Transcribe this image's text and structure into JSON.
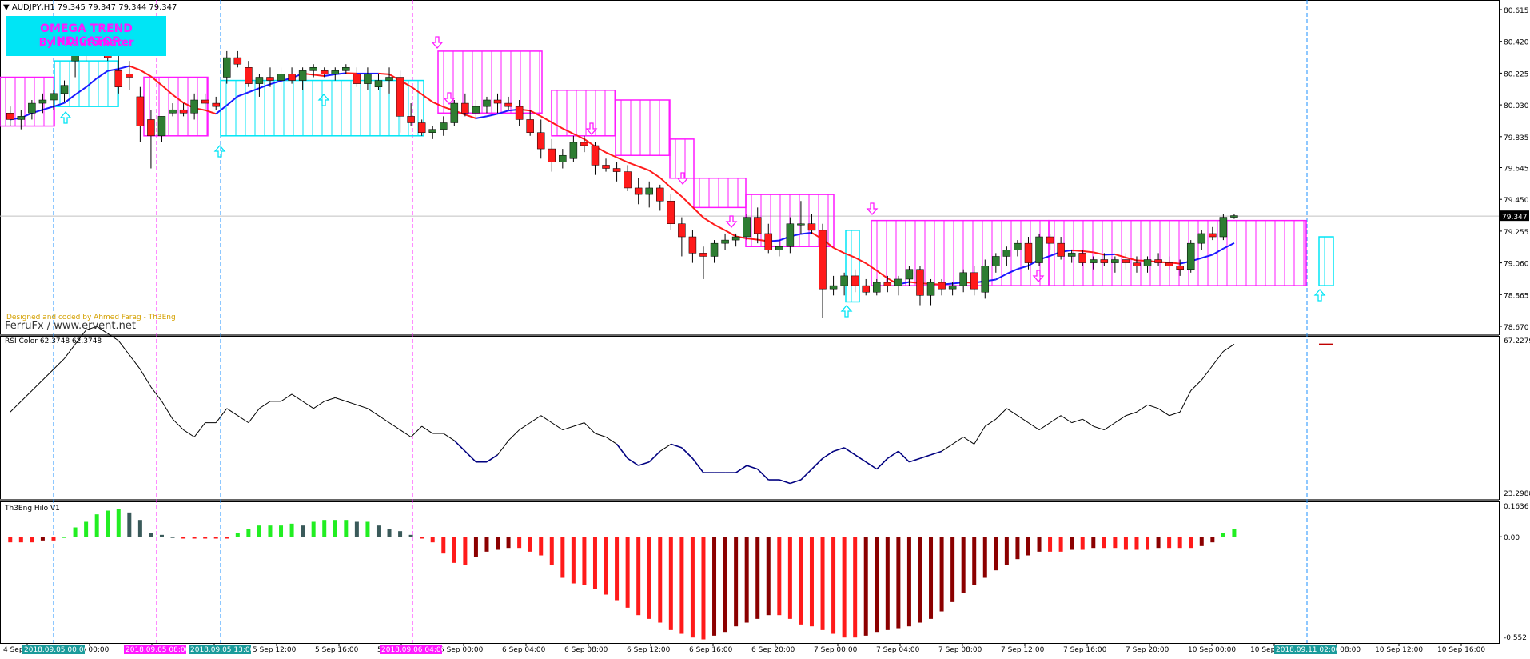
{
  "header": {
    "symbol_label": "AUDJPY,H1",
    "ohlc": "79.345 79.347 79.344 79.347"
  },
  "omega": {
    "title": "OMEGA TREND INDICATOR",
    "subtitle": "By FXautomater"
  },
  "credits": {
    "designed_by": "Designed and coded by Ahmed Farag - Th3Eng",
    "ferrufx": "FerruFx / www.ervent.net"
  },
  "price_axis": {
    "ticks": [
      "80.615",
      "80.420",
      "80.225",
      "80.030",
      "79.835",
      "79.645",
      "79.450",
      "79.255",
      "79.060",
      "78.865",
      "78.670"
    ],
    "current": "79.347"
  },
  "rsi": {
    "label": "RSI Color 62.3748 62.3748",
    "max": "67.2279",
    "min": "23.2988"
  },
  "hilo": {
    "label": "Th3Eng Hilo V1",
    "max": "0.1636",
    "zero": "0.00",
    "min": "-0.552"
  },
  "time_axis": {
    "labels": [
      "4 Sep",
      "5 Sep 00:00",
      "5 Sep 04:00",
      "5 Sep 08:00",
      "5 Sep 12:00",
      "5 Sep 16:00",
      "5 Sep 20:00",
      "6 Sep 00:00",
      "6 Sep 04:00",
      "6 Sep 08:00",
      "6 Sep 12:00",
      "6 Sep 16:00",
      "6 Sep 20:00",
      "7 Sep 00:00",
      "7 Sep 04:00",
      "7 Sep 08:00",
      "7 Sep 12:00",
      "7 Sep 16:00",
      "7 Sep 20:00",
      "10 Sep 00:00",
      "10 Sep 04:00",
      "10 Sep 08:00",
      "10 Sep 12:00",
      "10 Sep 16:00",
      "10 Sep 20:00"
    ],
    "highlights": [
      "2018.09.05 00:00",
      "2018.09.05 08:00",
      "2018.09.05 13:00",
      "2018.09.06 04:00",
      "2018.09.11 02:00"
    ]
  },
  "colors": {
    "bull_candle": "#2e7d32",
    "bear_candle": "#ff1a1a",
    "ma_up": "#1a1aff",
    "ma_down": "#ff1a1a",
    "box_buy": "#00e5f5",
    "box_sell": "#ff19ff",
    "hist_up": "#22ee22",
    "hist_up_weak": "#3a5a5a",
    "hist_down": "#ff1a1a",
    "hist_down_weak": "#8b0000",
    "rsi_line": "#000000",
    "rsi_low": "#000080"
  },
  "chart_data": {
    "type": "candlestick",
    "price_range": [
      78.67,
      80.615
    ],
    "candles": [
      [
        79.98,
        80.02,
        79.9,
        79.94
      ],
      [
        79.94,
        80.0,
        79.88,
        79.96
      ],
      [
        79.98,
        80.06,
        79.94,
        80.04
      ],
      [
        80.04,
        80.1,
        79.98,
        80.06
      ],
      [
        80.06,
        80.12,
        80.0,
        80.1
      ],
      [
        80.1,
        80.18,
        80.05,
        80.15
      ],
      [
        80.3,
        80.48,
        80.2,
        80.4
      ],
      [
        80.4,
        80.5,
        80.3,
        80.46
      ],
      [
        80.42,
        80.5,
        80.36,
        80.38
      ],
      [
        80.38,
        80.46,
        80.3,
        80.32
      ],
      [
        80.24,
        80.36,
        80.1,
        80.14
      ],
      [
        80.22,
        80.3,
        80.12,
        80.2
      ],
      [
        80.08,
        80.14,
        79.8,
        79.9
      ],
      [
        79.94,
        80.0,
        79.64,
        79.84
      ],
      [
        79.84,
        79.96,
        79.8,
        79.96
      ],
      [
        79.98,
        80.04,
        79.96,
        80.0
      ],
      [
        80.0,
        80.04,
        79.96,
        79.98
      ],
      [
        79.98,
        80.1,
        79.94,
        80.06
      ],
      [
        80.06,
        80.1,
        80.0,
        80.04
      ],
      [
        80.04,
        80.08,
        80.0,
        80.02
      ],
      [
        80.2,
        80.36,
        80.16,
        80.32
      ],
      [
        80.32,
        80.36,
        80.26,
        80.28
      ],
      [
        80.26,
        80.3,
        80.14,
        80.16
      ],
      [
        80.16,
        80.22,
        80.08,
        80.2
      ],
      [
        80.2,
        80.26,
        80.14,
        80.18
      ],
      [
        80.18,
        80.26,
        80.12,
        80.22
      ],
      [
        80.22,
        80.26,
        80.16,
        80.18
      ],
      [
        80.18,
        80.26,
        80.12,
        80.24
      ],
      [
        80.24,
        80.28,
        80.2,
        80.26
      ],
      [
        80.24,
        80.26,
        80.2,
        80.22
      ],
      [
        80.22,
        80.26,
        80.18,
        80.24
      ],
      [
        80.24,
        80.28,
        80.22,
        80.26
      ],
      [
        80.22,
        80.26,
        80.14,
        80.16
      ],
      [
        80.16,
        80.26,
        80.12,
        80.22
      ],
      [
        80.14,
        80.22,
        80.12,
        80.18
      ],
      [
        80.18,
        80.26,
        80.1,
        80.2
      ],
      [
        80.2,
        80.24,
        79.86,
        79.96
      ],
      [
        79.96,
        80.04,
        79.9,
        79.92
      ],
      [
        79.92,
        79.94,
        79.84,
        79.86
      ],
      [
        79.86,
        79.9,
        79.82,
        79.88
      ],
      [
        79.88,
        79.96,
        79.84,
        79.92
      ],
      [
        79.92,
        80.06,
        79.9,
        80.04
      ],
      [
        80.04,
        80.1,
        79.96,
        79.98
      ],
      [
        79.98,
        80.06,
        79.94,
        80.02
      ],
      [
        80.02,
        80.08,
        79.98,
        80.06
      ],
      [
        80.06,
        80.1,
        79.98,
        80.04
      ],
      [
        80.04,
        80.08,
        80.0,
        80.02
      ],
      [
        80.02,
        80.06,
        79.9,
        79.94
      ],
      [
        79.94,
        80.0,
        79.84,
        79.86
      ],
      [
        79.86,
        79.94,
        79.7,
        79.76
      ],
      [
        79.76,
        79.82,
        79.62,
        79.68
      ],
      [
        79.68,
        79.76,
        79.64,
        79.72
      ],
      [
        79.7,
        79.84,
        79.68,
        79.8
      ],
      [
        79.8,
        79.84,
        79.74,
        79.78
      ],
      [
        79.78,
        79.8,
        79.6,
        79.66
      ],
      [
        79.66,
        79.7,
        79.62,
        79.64
      ],
      [
        79.64,
        79.68,
        79.56,
        79.62
      ],
      [
        79.62,
        79.66,
        79.5,
        79.52
      ],
      [
        79.52,
        79.58,
        79.42,
        79.48
      ],
      [
        79.48,
        79.56,
        79.4,
        79.52
      ],
      [
        79.52,
        79.54,
        79.38,
        79.44
      ],
      [
        79.44,
        79.48,
        79.26,
        79.3
      ],
      [
        79.3,
        79.34,
        79.1,
        79.22
      ],
      [
        79.22,
        79.26,
        79.06,
        79.12
      ],
      [
        79.12,
        79.16,
        78.96,
        79.1
      ],
      [
        79.1,
        79.2,
        79.06,
        79.18
      ],
      [
        79.18,
        79.24,
        79.14,
        79.2
      ],
      [
        79.2,
        79.24,
        79.16,
        79.22
      ],
      [
        79.22,
        79.36,
        79.2,
        79.34
      ],
      [
        79.34,
        79.4,
        79.18,
        79.24
      ],
      [
        79.24,
        79.3,
        79.12,
        79.14
      ],
      [
        79.14,
        79.2,
        79.1,
        79.16
      ],
      [
        79.16,
        79.34,
        79.12,
        79.3
      ],
      [
        79.3,
        79.44,
        79.24,
        79.3
      ],
      [
        79.3,
        79.36,
        79.24,
        79.26
      ],
      [
        79.26,
        79.3,
        78.72,
        78.9
      ],
      [
        78.9,
        78.98,
        78.86,
        78.92
      ],
      [
        78.92,
        79.0,
        78.86,
        78.98
      ],
      [
        78.98,
        79.02,
        78.88,
        78.92
      ],
      [
        78.92,
        78.96,
        78.86,
        78.88
      ],
      [
        78.88,
        78.96,
        78.86,
        78.94
      ],
      [
        78.94,
        78.98,
        78.88,
        78.92
      ],
      [
        78.92,
        78.98,
        78.86,
        78.96
      ],
      [
        78.96,
        79.04,
        78.92,
        79.02
      ],
      [
        79.02,
        79.04,
        78.8,
        78.86
      ],
      [
        78.86,
        78.96,
        78.8,
        78.94
      ],
      [
        78.94,
        78.96,
        78.86,
        78.9
      ],
      [
        78.9,
        78.94,
        78.86,
        78.92
      ],
      [
        78.92,
        79.02,
        78.88,
        79.0
      ],
      [
        79.0,
        79.04,
        78.86,
        78.9
      ],
      [
        78.88,
        79.08,
        78.84,
        79.04
      ],
      [
        79.04,
        79.12,
        79.0,
        79.1
      ],
      [
        79.1,
        79.16,
        79.04,
        79.14
      ],
      [
        79.14,
        79.2,
        79.1,
        79.18
      ],
      [
        79.18,
        79.22,
        79.02,
        79.06
      ],
      [
        79.06,
        79.24,
        79.04,
        79.22
      ],
      [
        79.22,
        79.24,
        79.14,
        79.18
      ],
      [
        79.18,
        79.22,
        79.08,
        79.1
      ],
      [
        79.1,
        79.14,
        79.06,
        79.12
      ],
      [
        79.12,
        79.14,
        79.04,
        79.06
      ],
      [
        79.06,
        79.1,
        79.02,
        79.08
      ],
      [
        79.08,
        79.12,
        79.04,
        79.06
      ],
      [
        79.06,
        79.1,
        79.0,
        79.08
      ],
      [
        79.08,
        79.12,
        79.02,
        79.06
      ],
      [
        79.06,
        79.1,
        79.0,
        79.04
      ],
      [
        79.04,
        79.1,
        79.0,
        79.08
      ],
      [
        79.08,
        79.12,
        79.04,
        79.06
      ],
      [
        79.06,
        79.1,
        79.02,
        79.04
      ],
      [
        79.04,
        79.08,
        78.98,
        79.02
      ],
      [
        79.02,
        79.2,
        79.0,
        79.18
      ],
      [
        79.18,
        79.26,
        79.14,
        79.24
      ],
      [
        79.24,
        79.28,
        79.2,
        79.22
      ],
      [
        79.22,
        79.36,
        79.2,
        79.34
      ],
      [
        79.34,
        79.36,
        79.33,
        79.35
      ]
    ]
  }
}
